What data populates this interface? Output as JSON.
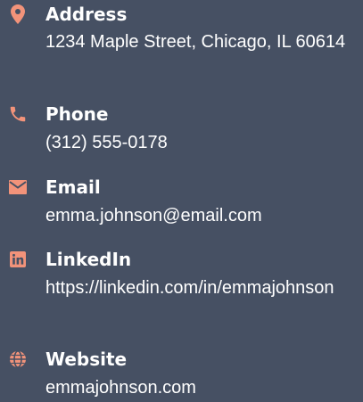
{
  "accent_color": "#f2937a",
  "background_color": "#465063",
  "contact": [
    {
      "icon": "map-pin-icon",
      "label": "Address",
      "value": "1234 Maple Street, Chicago, IL 60614"
    },
    {
      "icon": "phone-icon",
      "label": "Phone",
      "value": "(312) 555-0178"
    },
    {
      "icon": "envelope-icon",
      "label": "Email",
      "value": "emma.johnson@email.com"
    },
    {
      "icon": "linkedin-icon",
      "label": "LinkedIn",
      "value": "https://linkedin.com/in/emmajohnson"
    },
    {
      "icon": "globe-icon",
      "label": "Website",
      "value": "emmajohnson.com"
    }
  ]
}
